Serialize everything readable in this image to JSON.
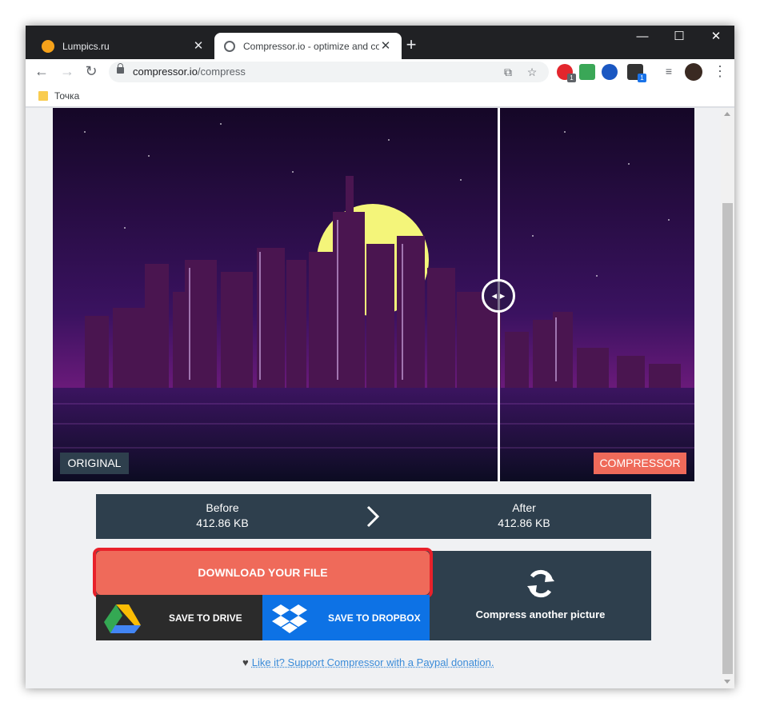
{
  "browser": {
    "tabs": [
      {
        "label": "Lumpics.ru",
        "active": false
      },
      {
        "label": "Compressor.io - optimize and co",
        "active": true
      }
    ],
    "url_host": "compressor.io",
    "url_path": "/compress",
    "bookmark": "Точка",
    "accent": "#202124"
  },
  "compare": {
    "original_label": "ORIGINAL",
    "compressed_label": "COMPRESSOR"
  },
  "sizes": {
    "before_label": "Before",
    "before_value": "412.86 KB",
    "after_label": "After",
    "after_value": "412.86 KB"
  },
  "actions": {
    "download_label": "DOWNLOAD YOUR FILE",
    "drive_label": "SAVE TO DRIVE",
    "dropbox_label": "SAVE TO DROPBOX",
    "another_label": "Compress another picture"
  },
  "donate": {
    "link_text": "Like it? Support Compressor with a Paypal donation."
  },
  "colors": {
    "primary": "#ef6a5a",
    "panel": "#2e3f4d",
    "dropbox": "#0d72e5",
    "highlight": "#e8212a"
  },
  "extension_badges": [
    "1",
    "1"
  ]
}
